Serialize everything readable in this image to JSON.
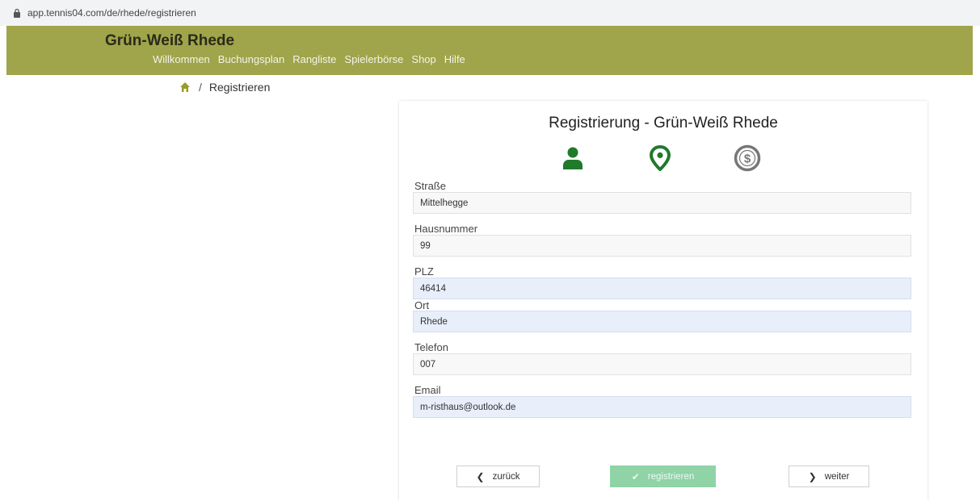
{
  "browser": {
    "url": "app.tennis04.com/de/rhede/registrieren"
  },
  "header": {
    "brand": "Grün-Weiß Rhede",
    "nav": [
      "Willkommen",
      "Buchungsplan",
      "Rangliste",
      "Spielerbörse",
      "Shop",
      "Hilfe"
    ]
  },
  "breadcrumb": {
    "separator": "/",
    "current": "Registrieren"
  },
  "form": {
    "title": "Registrierung - Grün-Weiß Rhede",
    "steps": [
      {
        "icon": "user-icon",
        "color": "#1f7a2c"
      },
      {
        "icon": "location-pin-icon",
        "color": "#1f7a2c"
      },
      {
        "icon": "dollar-circle-icon",
        "color": "#777777"
      }
    ],
    "fields": [
      {
        "label": "Straße",
        "value": "Mittelhegge"
      },
      {
        "label": "Hausnummer",
        "value": "99"
      },
      {
        "label": "PLZ",
        "value": "46414"
      },
      {
        "label": "Ort",
        "value": "Rhede"
      },
      {
        "label": "Telefon",
        "value": "007"
      },
      {
        "label": "Email",
        "value": "m-risthaus@outlook.de"
      }
    ],
    "buttons": {
      "back": "zurück",
      "register": "registrieren",
      "next": "weiter"
    }
  },
  "colors": {
    "header_bg": "#a0a44a",
    "accent_green": "#1f7a2c",
    "register_btn": "#8fd3a6",
    "autofill_bg": "#e8effb"
  }
}
